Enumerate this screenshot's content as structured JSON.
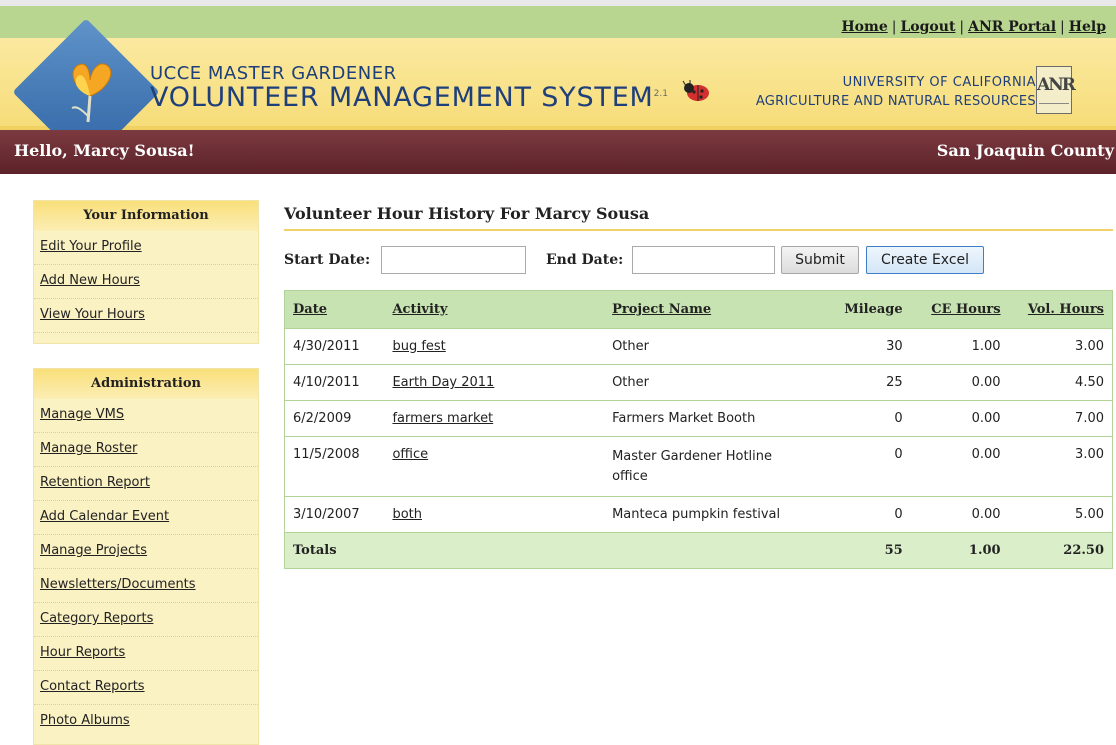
{
  "toplinks": [
    "Home",
    "Logout",
    "ANR Portal",
    "Help"
  ],
  "banner": {
    "system_line1": "UCCE Master Gardener",
    "system_line2": "Volunteer Management System",
    "version": "2.1",
    "univ_line1": "University of California",
    "univ_line2": "Agriculture and Natural Resources",
    "anr_logo": "ANR"
  },
  "userbar": {
    "hello": "Hello, Marcy Sousa!",
    "county": "San Joaquin County"
  },
  "sidebar": {
    "info": {
      "title": "Your Information",
      "items": [
        "Edit Your Profile",
        "Add New Hours",
        "View Your Hours"
      ]
    },
    "admin": {
      "title": "Administration",
      "items": [
        "Manage VMS",
        "Manage Roster",
        "Retention Report",
        "Add Calendar Event",
        "Manage Projects",
        "Newsletters/Documents",
        "Category Reports",
        "Hour Reports",
        "Contact Reports",
        "Photo Albums"
      ]
    }
  },
  "main": {
    "title": "Volunteer Hour History For Marcy Sousa",
    "filter": {
      "start_label": "Start Date:",
      "start_value": "",
      "end_label": "End Date:",
      "end_value": "",
      "submit": "Submit",
      "excel": "Create Excel"
    },
    "table": {
      "headers": [
        "Date",
        "Activity",
        "Project Name",
        "Mileage",
        "CE Hours",
        "Vol. Hours"
      ],
      "rows": [
        {
          "date": "4/30/2011",
          "activity": "bug fest",
          "project": "Other",
          "mileage": "30",
          "ce": "1.00",
          "vol": "3.00"
        },
        {
          "date": "4/10/2011",
          "activity": "Earth Day 2011",
          "project": "Other",
          "mileage": "25",
          "ce": "0.00",
          "vol": "4.50"
        },
        {
          "date": "6/2/2009",
          "activity": "farmers market",
          "project": "Farmers Market Booth",
          "mileage": "0",
          "ce": "0.00",
          "vol": "7.00"
        },
        {
          "date": "11/5/2008",
          "activity": "office",
          "project": "Master Gardener Hotline office",
          "mileage": "0",
          "ce": "0.00",
          "vol": "3.00"
        },
        {
          "date": "3/10/2007",
          "activity": "both",
          "project": "Manteca pumpkin festival",
          "mileage": "0",
          "ce": "0.00",
          "vol": "5.00"
        }
      ],
      "totals": {
        "label": "Totals",
        "mileage": "55",
        "ce": "1.00",
        "vol": "22.50"
      }
    }
  }
}
